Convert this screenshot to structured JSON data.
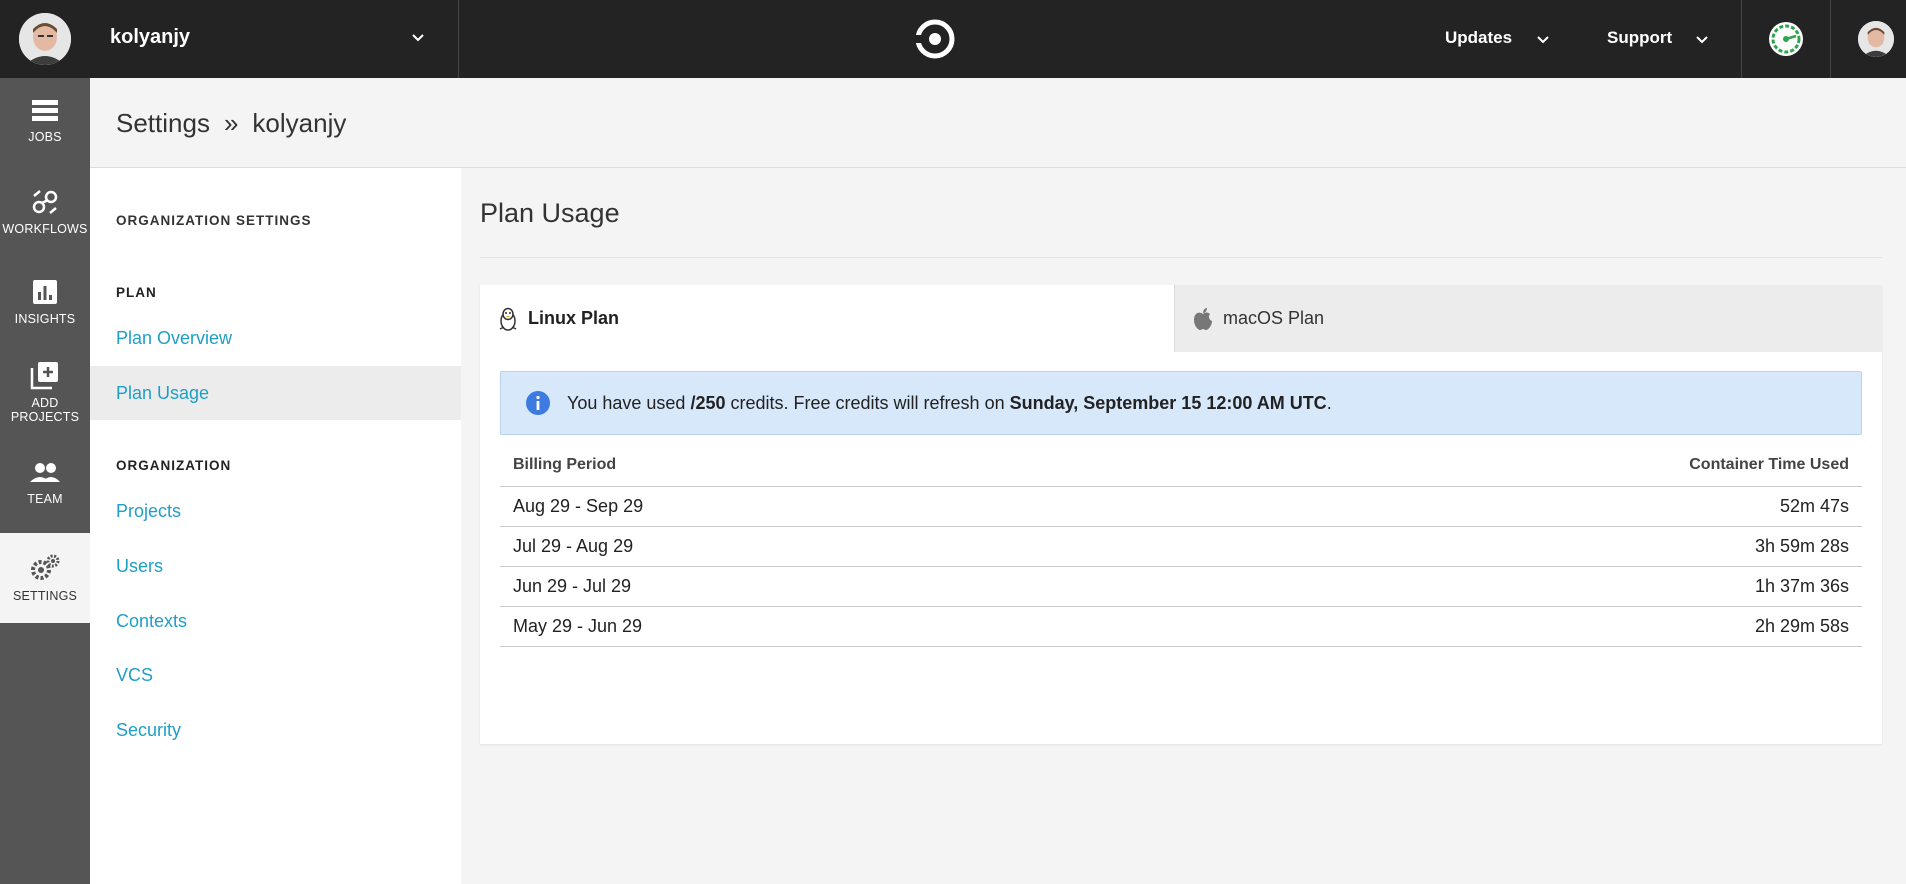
{
  "topbar": {
    "org_name": "kolyanjy",
    "nav": {
      "updates": "Updates",
      "support": "Support"
    }
  },
  "sidenav": {
    "items": [
      {
        "label": "JOBS",
        "icon": "jobs-icon"
      },
      {
        "label": "WORKFLOWS",
        "icon": "workflows-icon"
      },
      {
        "label": "INSIGHTS",
        "icon": "insights-icon"
      },
      {
        "label_line1": "ADD",
        "label_line2": "PROJECTS",
        "icon": "add-projects-icon"
      },
      {
        "label": "TEAM",
        "icon": "team-icon"
      },
      {
        "label": "SETTINGS",
        "icon": "settings-icon",
        "active": true
      }
    ]
  },
  "breadcrumb": {
    "root": "Settings",
    "separator": "»",
    "current": "kolyanjy"
  },
  "settings_menu": {
    "heading": "ORGANIZATION SETTINGS",
    "plan_heading": "PLAN",
    "plan_links": [
      "Plan Overview",
      "Plan Usage"
    ],
    "org_heading": "ORGANIZATION",
    "org_links": [
      "Projects",
      "Users",
      "Contexts",
      "VCS",
      "Security"
    ]
  },
  "main": {
    "title": "Plan Usage",
    "tabs": [
      {
        "label": "Linux Plan",
        "icon": "linux-icon",
        "active": true
      },
      {
        "label": "macOS Plan",
        "icon": "apple-icon",
        "active": false
      }
    ],
    "alert": {
      "icon": "info-icon",
      "prefix": "You have used ",
      "credits": "/250",
      "middle": " credits. Free credits will refresh on ",
      "refresh_date": "Sunday, September 15 12:00 AM UTC",
      "suffix": "."
    },
    "table": {
      "headers": [
        "Billing Period",
        "Container Time Used"
      ],
      "rows": [
        [
          "Aug 29 - Sep 29",
          "52m 47s"
        ],
        [
          "Jul 29 - Aug 29",
          "3h 59m 28s"
        ],
        [
          "Jun 29 - Jul 29",
          "1h 37m 36s"
        ],
        [
          "May 29 - Jun 29",
          "2h 29m 58s"
        ]
      ]
    }
  },
  "colors": {
    "topbar_bg": "#232323",
    "sidenav_bg": "#555555",
    "link": "#1e9fc6",
    "alert_bg": "#d8e8fb",
    "status_green": "#2ea44f"
  }
}
